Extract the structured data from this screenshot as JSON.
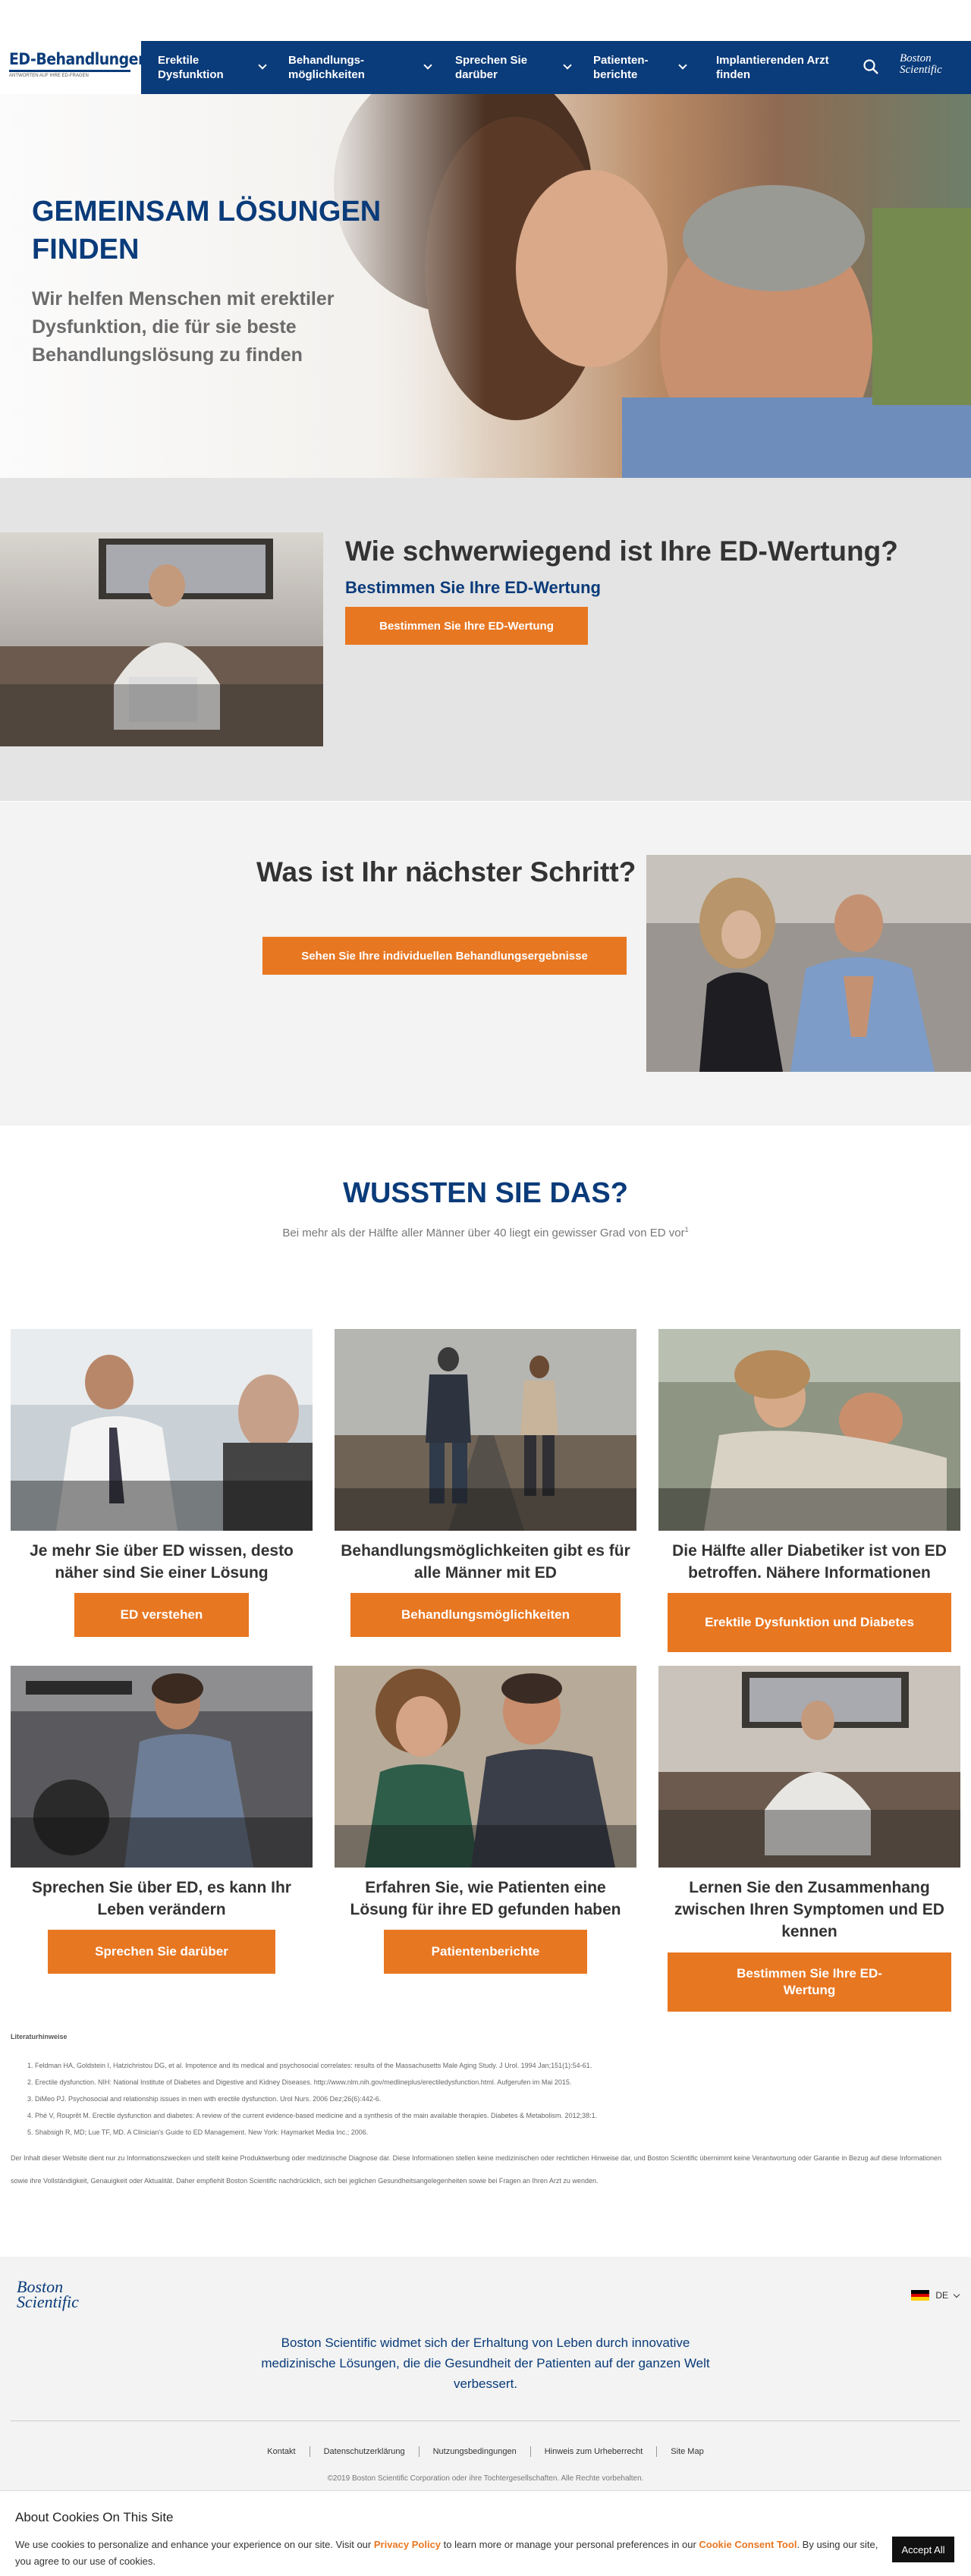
{
  "header": {
    "logo_title": "ED-Behandlungen.de",
    "logo_tagline": "ANTWORTEN AUF IHRE ED-FRAGEN",
    "nav": [
      {
        "label": "Erektile Dysfunktion"
      },
      {
        "label": "Behandlungs-möglichkeiten"
      },
      {
        "label": "Sprechen Sie darüber"
      },
      {
        "label": "Patienten-berichte"
      },
      {
        "label": "Implantierenden Arzt finden"
      }
    ],
    "brand": "Boston Scientific"
  },
  "hero": {
    "title": "GEMEINSAM LÖSUNGEN FINDEN",
    "subtitle": "Wir helfen Menschen mit erektiler Dysfunktion, die für sie beste Behandlungslösung zu finden"
  },
  "score": {
    "heading": "Wie schwerwiegend ist Ihre ED-Wertung?",
    "subheading": "Bestimmen Sie Ihre ED-Wertung",
    "button": "Bestimmen Sie Ihre ED-Wertung"
  },
  "next_step": {
    "heading": "Was ist Ihr nächster Schritt?",
    "button": "Sehen Sie Ihre individuellen Behandlungsergebnisse"
  },
  "did_you_know": {
    "heading": "WUSSTEN SIE DAS?",
    "text": "Bei mehr als der Hälfte aller Männer über 40 liegt ein gewisser Grad von ED vor",
    "sup": "1"
  },
  "cards": [
    {
      "title": "Je mehr Sie über ED wissen, desto näher sind Sie einer Lösung",
      "button": "ED verstehen"
    },
    {
      "title": "Behandlungsmöglichkeiten gibt es für alle Männer mit ED",
      "button": "Behandlungsmöglichkeiten"
    },
    {
      "title": "Die Hälfte aller Diabetiker ist von ED betroffen. Nähere Informationen",
      "button": "Erektile Dysfunktion und Diabetes"
    },
    {
      "title": "Sprechen Sie über ED, es kann Ihr Leben verändern",
      "button": "Sprechen Sie darüber"
    },
    {
      "title": "Erfahren Sie, wie Patienten eine Lösung für ihre ED gefunden haben",
      "button": "Patientenberichte"
    },
    {
      "title": "Lernen Sie den Zusammenhang zwischen Ihren Symptomen und ED kennen",
      "button": "Bestimmen Sie Ihre ED-Wertung"
    }
  ],
  "references": {
    "heading": "Literaturhinweise",
    "items": [
      "Feldman HA, Goldstein I, Hatzichristou DG, et al. Impotence and its medical and psychosocial correlates: results of the Massachusetts Male Aging Study. J Urol. 1994 Jan;151(1):54-61.",
      "Erectile dysfunction. NIH: National Institute of Diabetes and Digestive and Kidney Diseases. http://www.nlm.nih.gov/medlineplus/erectiledysfunction.html. Aufgerufen im Mai 2015.",
      "DiMeo PJ. Psychosocial and relationship issues in men with erectile dysfunction. Urol Nurs. 2006 Dez;26(6):442-6.",
      "Phé V, Rouprêt M. Erectile dysfunction and diabetes: A review of the current evidence-based medicine and a synthesis of the main available therapies. Diabetes & Metabolism. 2012;38:1.",
      "Shabsigh R, MD; Lue TF, MD. A Clinician's Guide to ED Management. New York: Haymarket Media Inc.; 2006."
    ],
    "disclaimer": "Der Inhalt dieser Website dient nur zu Informationszwecken und stellt keine Produktwerbung oder medizinische Diagnose dar. Diese Informationen stellen keine medizinischen oder rechtlichen Hinweise dar, und Boston Scientific übernimmt keine Verantwortung oder Garantie in Bezug auf diese Informationen sowie ihre Vollständigkeit, Genauigkeit oder Aktualität. Daher empfiehlt Boston Scientific nachdrücklich, sich bei jeglichen Gesundheitsangelegenheiten sowie bei Fragen an Ihren Arzt zu wenden."
  },
  "footer": {
    "brand": "Boston Scientific",
    "language": "DE",
    "mission": "Boston Scientific widmet sich der Erhaltung von Leben durch innovative medizinische Lösungen, die die Gesundheit der Patienten auf der ganzen Welt verbessert.",
    "links": [
      "Kontakt",
      "Datenschutzerklärung",
      "Nutzungsbedingungen",
      "Hinweis zum Urheberrecht",
      "Site Map"
    ],
    "copyright": "©2019 Boston Scientific Corporation oder ihre Tochtergesellschaften. Alle Rechte vorbehalten."
  },
  "cookie": {
    "heading": "About Cookies On This Site",
    "text_1": "We use cookies to personalize and enhance your experience on our site. Visit our ",
    "link_1": "Privacy Policy",
    "text_2": " to learn more or manage your personal preferences in our ",
    "link_2": "Cookie Consent Tool",
    "text_3": ". By using our site, you agree to our use of cookies.",
    "button": "Accept All"
  }
}
